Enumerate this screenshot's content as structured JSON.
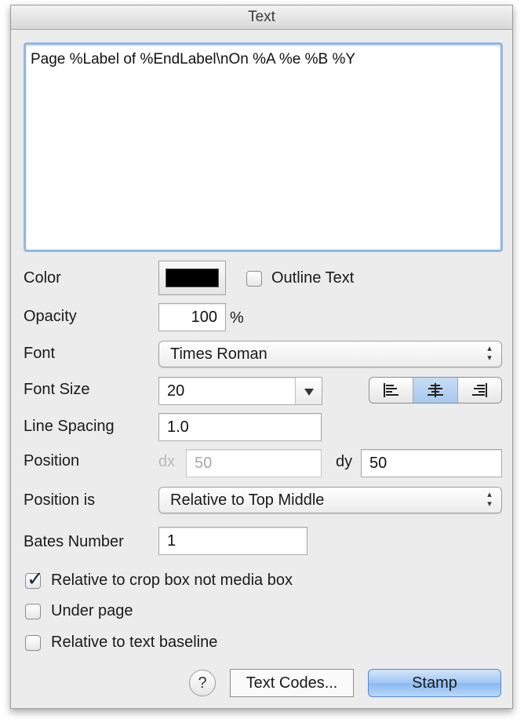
{
  "panel": {
    "title": "Text"
  },
  "text_area": {
    "value": "Page %Label of %EndLabel\\nOn %A %e %B %Y"
  },
  "color": {
    "label": "Color",
    "swatch_color": "#000000",
    "outline_label": "Outline Text",
    "outline_checked": false
  },
  "opacity": {
    "label": "Opacity",
    "value": "100",
    "unit": "%"
  },
  "font": {
    "label": "Font",
    "value": "Times Roman"
  },
  "font_size": {
    "label": "Font Size",
    "value": "20",
    "alignment_selected": "center",
    "alignment_options": [
      "left",
      "center",
      "right"
    ]
  },
  "line_spacing": {
    "label": "Line Spacing",
    "value": "1.0"
  },
  "position": {
    "label": "Position",
    "dx_label": "dx",
    "dx_value": "50",
    "dy_label": "dy",
    "dy_value": "50"
  },
  "position_is": {
    "label": "Position is",
    "value": "Relative to Top Middle"
  },
  "bates": {
    "label": "Bates Number",
    "value": "1"
  },
  "options": {
    "crop_box_label": "Relative to crop box not media box",
    "crop_box_checked": true,
    "under_page_label": "Under page",
    "under_page_checked": false,
    "baseline_label": "Relative to text baseline",
    "baseline_checked": false
  },
  "footer": {
    "help_label": "?",
    "text_codes_label": "Text Codes...",
    "stamp_label": "Stamp"
  }
}
